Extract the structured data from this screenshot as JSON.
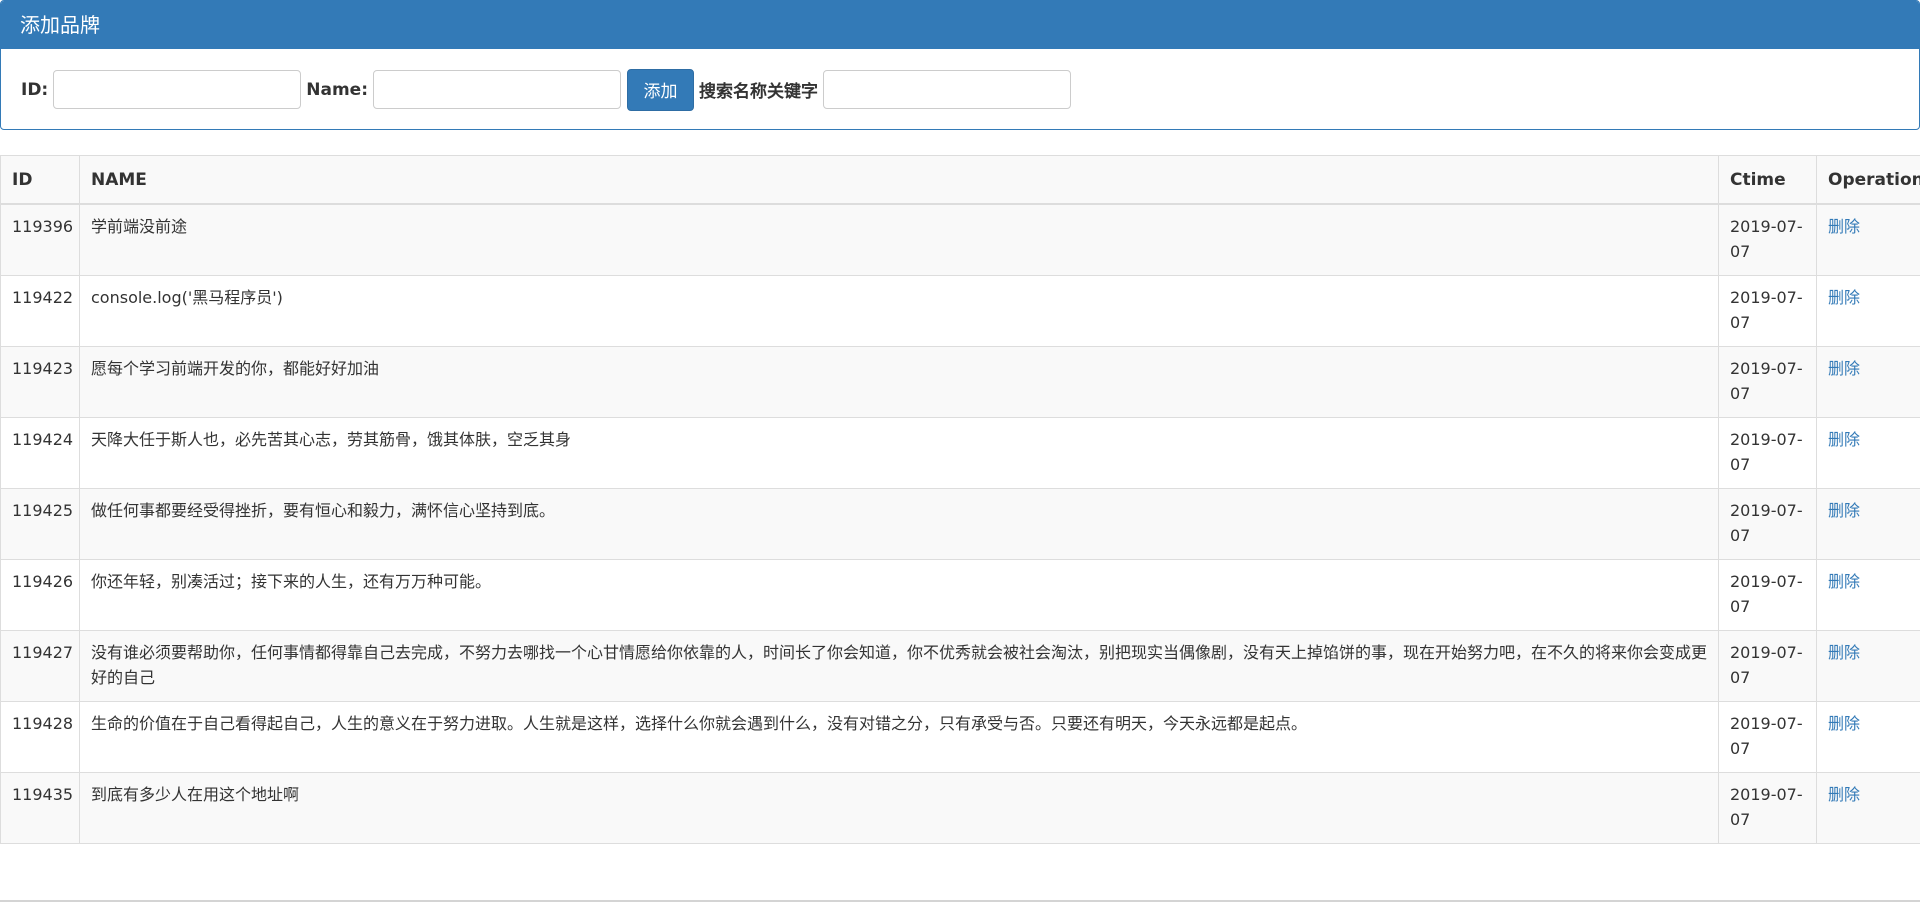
{
  "panel": {
    "title": "添加品牌"
  },
  "form": {
    "id_label": "ID:",
    "id_value": "",
    "name_label": "Name:",
    "name_value": "",
    "add_button": "添加",
    "search_label": "搜索名称关键字",
    "search_value": ""
  },
  "table": {
    "headers": {
      "id": "ID",
      "name": "NAME",
      "ctime": "Ctime",
      "operation": "Operation"
    },
    "rows": [
      {
        "id": "119396",
        "name": "学前端没前途",
        "ctime": "2019-07-07",
        "op": "删除"
      },
      {
        "id": "119422",
        "name": "console.log('黑马程序员')",
        "ctime": "2019-07-07",
        "op": "删除"
      },
      {
        "id": "119423",
        "name": "愿每个学习前端开发的你，都能好好加油",
        "ctime": "2019-07-07",
        "op": "删除"
      },
      {
        "id": "119424",
        "name": "天降大任于斯人也，必先苦其心志，劳其筋骨，饿其体肤，空乏其身",
        "ctime": "2019-07-07",
        "op": "删除"
      },
      {
        "id": "119425",
        "name": "做任何事都要经受得挫折，要有恒心和毅力，满怀信心坚持到底。",
        "ctime": "2019-07-07",
        "op": "删除"
      },
      {
        "id": "119426",
        "name": "你还年轻，别凑活过；接下来的人生，还有万万种可能。",
        "ctime": "2019-07-07",
        "op": "删除"
      },
      {
        "id": "119427",
        "name": "没有谁必须要帮助你，任何事情都得靠自己去完成，不努力去哪找一个心甘情愿给你依靠的人，时间长了你会知道，你不优秀就会被社会淘汰，别把现实当偶像剧，没有天上掉馅饼的事，现在开始努力吧，在不久的将来你会变成更好的自己",
        "ctime": "2019-07-07",
        "op": "删除"
      },
      {
        "id": "119428",
        "name": "生命的价值在于自己看得起自己，人生的意义在于努力进取。人生就是这样，选择什么你就会遇到什么，没有对错之分，只有承受与否。只要还有明天，今天永远都是起点。",
        "ctime": "2019-07-07",
        "op": "删除"
      },
      {
        "id": "119435",
        "name": "到底有多少人在用这个地址啊",
        "ctime": "2019-07-07",
        "op": "删除"
      }
    ]
  }
}
